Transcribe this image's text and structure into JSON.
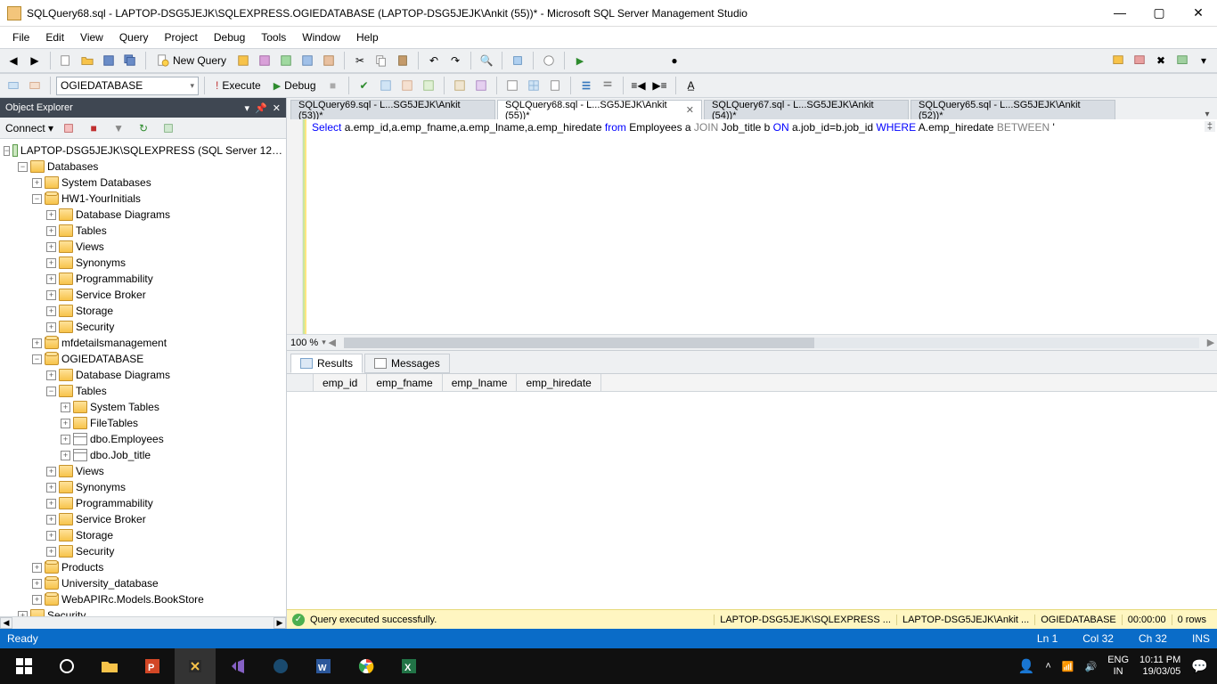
{
  "window": {
    "title": "SQLQuery68.sql - LAPTOP-DSG5JEJK\\SQLEXPRESS.OGIEDATABASE (LAPTOP-DSG5JEJK\\Ankit (55))* - Microsoft SQL Server Management Studio"
  },
  "menu": [
    "File",
    "Edit",
    "View",
    "Query",
    "Project",
    "Debug",
    "Tools",
    "Window",
    "Help"
  ],
  "toolbar1": {
    "newquery": "New Query"
  },
  "toolbar2": {
    "database": "OGIEDATABASE",
    "execute": "Execute",
    "debug": "Debug"
  },
  "object_explorer": {
    "title": "Object Explorer",
    "connect": "Connect ▾",
    "server": "LAPTOP-DSG5JEJK\\SQLEXPRESS (SQL Server 12…",
    "nodes": {
      "databases": "Databases",
      "sysdb": "System Databases",
      "hw1": "HW1-YourInitials",
      "dbdiag": "Database Diagrams",
      "tables": "Tables",
      "views": "Views",
      "syn": "Synonyms",
      "prog": "Programmability",
      "svcbrk": "Service Broker",
      "storage": "Storage",
      "security": "Security",
      "mfd": "mfdetailsmanagement",
      "ogie": "OGIEDATABASE",
      "systables": "System Tables",
      "filetables": "FileTables",
      "emp": "dbo.Employees",
      "jobt": "dbo.Job_title",
      "products": "Products",
      "univ": "University_database",
      "webapi": "WebAPIRc.Models.BookStore",
      "security2": "Security"
    }
  },
  "tabs": [
    {
      "label": "SQLQuery69.sql - L...SG5JEJK\\Ankit (53))*",
      "active": false,
      "close": false
    },
    {
      "label": "SQLQuery68.sql - L...SG5JEJK\\Ankit (55))*",
      "active": true,
      "close": true
    },
    {
      "label": "SQLQuery67.sql - L...SG5JEJK\\Ankit (54))*",
      "active": false,
      "close": false
    },
    {
      "label": "SQLQuery65.sql - L...SG5JEJK\\Ankit (52))*",
      "active": false,
      "close": false
    }
  ],
  "code": {
    "kw_select": "Select ",
    "seg1": "a.emp_id,a.emp_fname,a.emp_lname,a.emp_hiredate ",
    "kw_from": "from ",
    "seg2": "Employees a ",
    "kw_join": "JOIN ",
    "seg3": "Job_title b ",
    "kw_on": "ON ",
    "seg4": "a.job_id=b.job_id ",
    "kw_where": "WHERE ",
    "seg5": "A.emp_hiredate ",
    "kw_between": "BETWEEN ",
    "tail": "'"
  },
  "zoom": "100 %",
  "results": {
    "tab_results": "Results",
    "tab_messages": "Messages",
    "cols": [
      "emp_id",
      "emp_fname",
      "emp_lname",
      "emp_hiredate"
    ]
  },
  "execstatus": {
    "msg": "Query executed successfully.",
    "server": "LAPTOP-DSG5JEJK\\SQLEXPRESS ...",
    "user": "LAPTOP-DSG5JEJK\\Ankit ...",
    "db": "OGIEDATABASE",
    "time": "00:00:00",
    "rows": "0 rows"
  },
  "statusbar": {
    "ready": "Ready",
    "ln": "Ln 1",
    "col": "Col 32",
    "ch": "Ch 32",
    "ins": "INS"
  },
  "taskbar": {
    "lang1": "ENG",
    "lang2": "IN",
    "time": "10:11 PM",
    "date": "19/03/05"
  }
}
